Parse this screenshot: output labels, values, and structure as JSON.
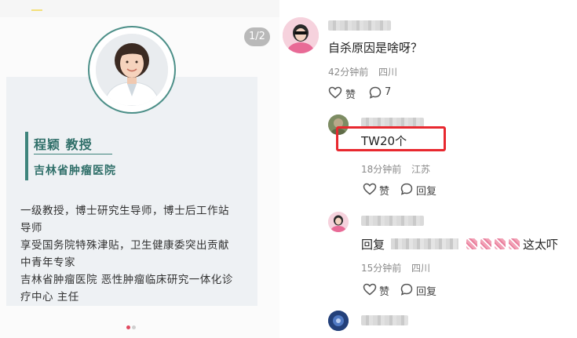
{
  "left_panel": {
    "page_indicator": "1/2",
    "profile": {
      "name": "程颖 教授",
      "hospital": "吉林省肿瘤医院",
      "bio_lines": [
        "一级教授，博士研究生导师，博士后工作站",
        "导师",
        "享受国务院特殊津贴，卫生健康委突出贡献",
        "中青年专家",
        "吉林省肿瘤医院 恶性肿瘤临床研究一体化诊",
        "疗中心 主任"
      ]
    },
    "carousel_dots": 2,
    "colors": {
      "accent": "#3e847c",
      "name_text": "#2f6f69",
      "card_bg": "#eef1f4"
    }
  },
  "comments": [
    {
      "text": "自杀原因是啥呀？",
      "time": "42分钟前",
      "location": "四川",
      "like_label": "赞",
      "reply_count": "7"
    },
    {
      "text": "TW20个",
      "time": "18分钟前",
      "location": "江苏",
      "like_label": "赞",
      "reply_label": "回复"
    },
    {
      "reply_prefix": "回复",
      "text_suffix": "这太吓",
      "time": "15分钟前",
      "location": "四川",
      "like_label": "赞",
      "reply_label": "回复"
    }
  ],
  "colors": {
    "highlight": "#e8282f",
    "meta_text": "#8a8a8a"
  },
  "icons": [
    "heart-outline-icon",
    "speech-bubble-icon"
  ]
}
